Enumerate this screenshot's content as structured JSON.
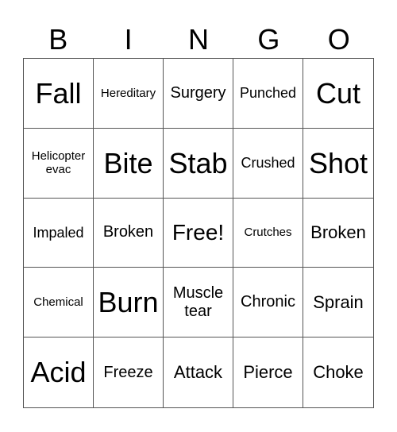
{
  "header": [
    "B",
    "I",
    "N",
    "G",
    "O"
  ],
  "cells": [
    {
      "text": "Fall",
      "size": "s-xl"
    },
    {
      "text": "Hereditary",
      "size": "s-xs"
    },
    {
      "text": "Surgery",
      "size": "s-m"
    },
    {
      "text": "Punched",
      "size": "s-s"
    },
    {
      "text": "Cut",
      "size": "s-xl"
    },
    {
      "text": "Helicopter evac",
      "size": "s-xs"
    },
    {
      "text": "Bite",
      "size": "s-xl"
    },
    {
      "text": "Stab",
      "size": "s-xl"
    },
    {
      "text": "Crushed",
      "size": "s-s"
    },
    {
      "text": "Shot",
      "size": "s-xl"
    },
    {
      "text": "Impaled",
      "size": "s-s"
    },
    {
      "text": "Broken",
      "size": "s-m"
    },
    {
      "text": "Free!",
      "size": "s-l"
    },
    {
      "text": "Crutches",
      "size": "s-xs"
    },
    {
      "text": "Broken",
      "size": "s-ml"
    },
    {
      "text": "Chemical",
      "size": "s-xs"
    },
    {
      "text": "Burn",
      "size": "s-xl"
    },
    {
      "text": "Muscle tear",
      "size": "s-m"
    },
    {
      "text": "Chronic",
      "size": "s-m"
    },
    {
      "text": "Sprain",
      "size": "s-ml"
    },
    {
      "text": "Acid",
      "size": "s-xl"
    },
    {
      "text": "Freeze",
      "size": "s-m"
    },
    {
      "text": "Attack",
      "size": "s-ml"
    },
    {
      "text": "Pierce",
      "size": "s-ml"
    },
    {
      "text": "Choke",
      "size": "s-ml"
    }
  ]
}
